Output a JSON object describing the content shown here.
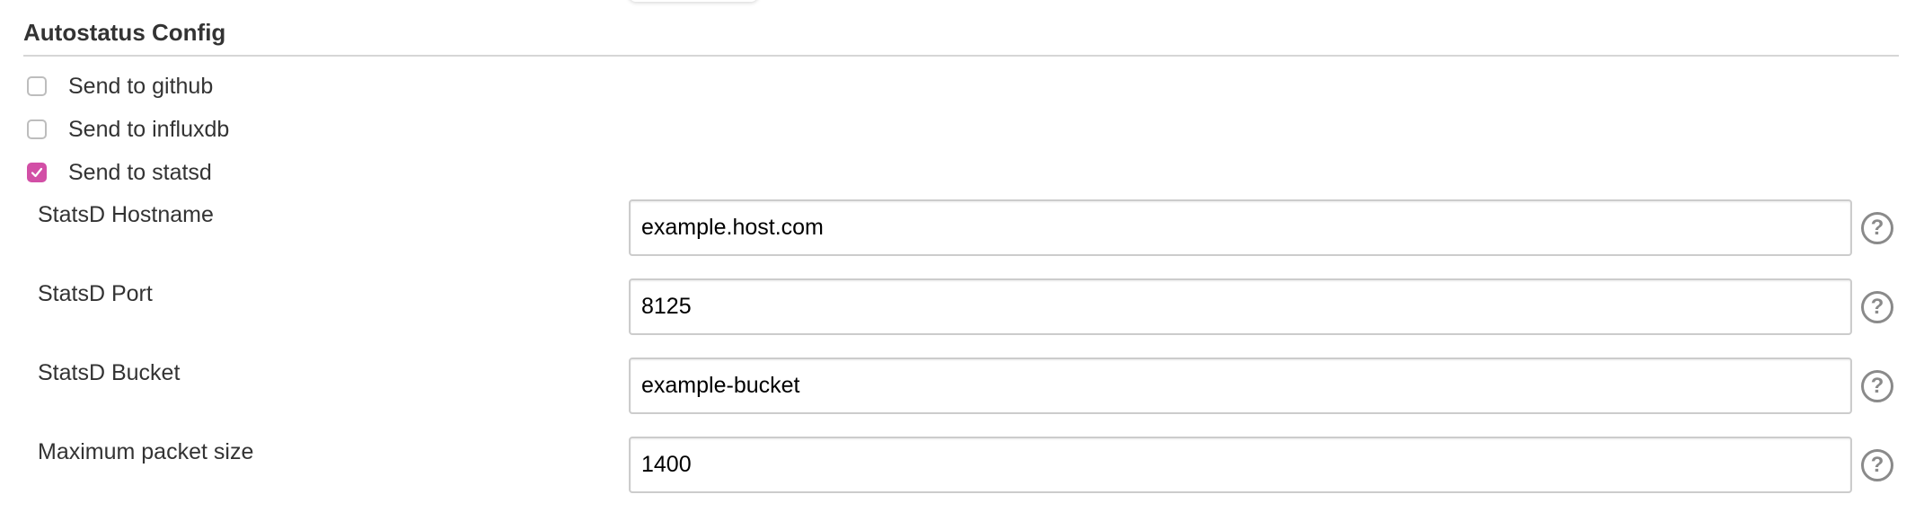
{
  "section": {
    "title": "Autostatus Config"
  },
  "checkboxes": [
    {
      "label": "Send to github",
      "checked": false
    },
    {
      "label": "Send to influxdb",
      "checked": false
    },
    {
      "label": "Send to statsd",
      "checked": true
    }
  ],
  "fields": [
    {
      "label": "StatsD Hostname",
      "value": "example.host.com",
      "help": "?"
    },
    {
      "label": "StatsD Port",
      "value": "8125",
      "help": "?"
    },
    {
      "label": "StatsD Bucket",
      "value": "example-bucket",
      "help": "?"
    },
    {
      "label": "Maximum packet size",
      "value": "1400",
      "help": "?"
    }
  ],
  "colors": {
    "accent": "#d24fa6",
    "text": "#333333",
    "border": "#cccccc",
    "help_icon": "#8a8a8a"
  },
  "icons": {
    "checked": "check-icon",
    "help": "help-icon"
  }
}
